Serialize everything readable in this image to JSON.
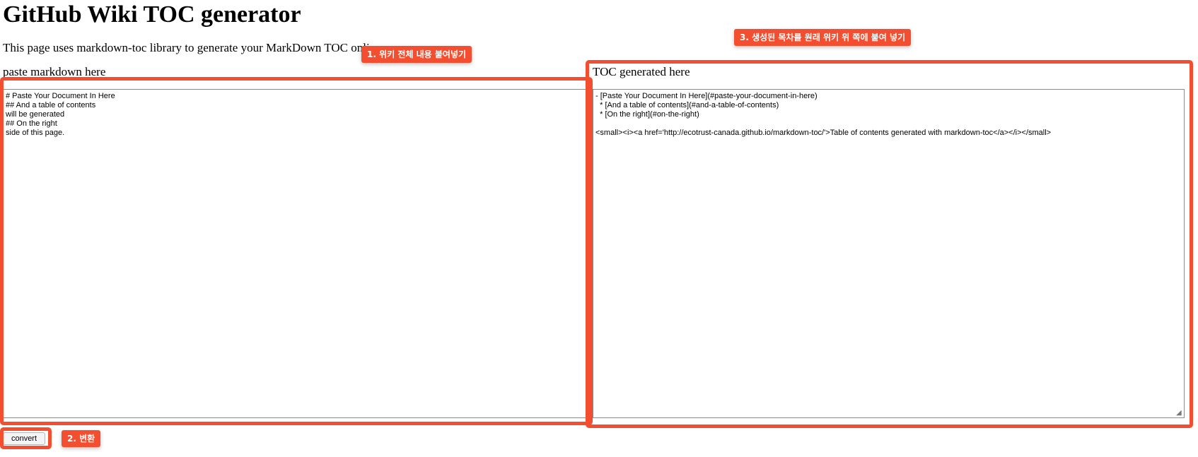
{
  "page": {
    "title": "GitHub Wiki TOC generator",
    "intro": "This page uses markdown-toc library to generate your MarkDown TOC online."
  },
  "input": {
    "label": "paste markdown here",
    "value": "# Paste Your Document In Here\n## And a table of contents\nwill be generated\n## On the right\nside of this page."
  },
  "output": {
    "label": "TOC generated here",
    "value": "- [Paste Your Document In Here](#paste-your-document-in-here)\n  * [And a table of contents](#and-a-table-of-contents)\n  * [On the right](#on-the-right)\n\n<small><i><a href='http://ecotrust-canada.github.io/markdown-toc/'>Table of contents generated with markdown-toc</a></i></small>"
  },
  "actions": {
    "convert_label": "convert"
  },
  "annotations": {
    "step1": "1. 위키 전체 내용 붙여넣기",
    "step2": "2. 변환",
    "step3": "3. 생성된 목차를 원래 위키 위 쪽에 붙여 넣기"
  },
  "colors": {
    "annotation_accent": "#f24e2f"
  }
}
